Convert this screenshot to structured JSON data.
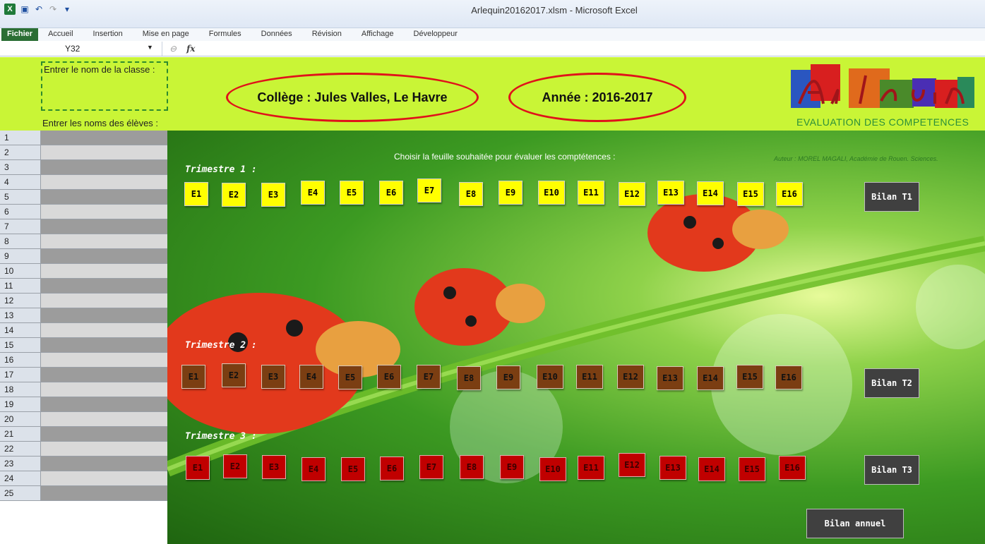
{
  "window": {
    "title": "Arlequin20162017.xlsm  -  Microsoft Excel"
  },
  "ribbon": {
    "tabs": [
      "Fichier",
      "Accueil",
      "Insertion",
      "Mise en page",
      "Formules",
      "Données",
      "Révision",
      "Affichage",
      "Développeur"
    ]
  },
  "formula_bar": {
    "name_box": "Y32",
    "fx": "fx",
    "value": ""
  },
  "header": {
    "class_prompt": "Entrer le nom de la classe :",
    "names_prompt": "Entrer les noms des élèves :",
    "college": "Collège : Jules Valles, Le Havre",
    "year": "Année : 2016-2017",
    "logo_subtitle": "EVALUATION DES COMPETENCES"
  },
  "instruction": "Choisir la feuille souhaitée pour évaluer les comptétences :",
  "author": "Auteur : MOREL MAGALI, Académie de Rouen. Sciences.",
  "rows": [
    "1",
    "2",
    "3",
    "4",
    "5",
    "6",
    "7",
    "8",
    "9",
    "10",
    "11",
    "12",
    "13",
    "14",
    "15",
    "16",
    "17",
    "18",
    "19",
    "20",
    "21",
    "22",
    "23",
    "24",
    "25"
  ],
  "trimesters": [
    {
      "label": "Trimestre 1 :",
      "bilan": "Bilan T1",
      "buttons": [
        "E1",
        "E2",
        "E3",
        "E4",
        "E5",
        "E6",
        "E7",
        "E8",
        "E9",
        "E10",
        "E11",
        "E12",
        "E13",
        "E14",
        "E15",
        "E16"
      ]
    },
    {
      "label": "Trimestre 2 :",
      "bilan": "Bilan T2",
      "buttons": [
        "E1",
        "E2",
        "E3",
        "E4",
        "E5",
        "E6",
        "E7",
        "E8",
        "E9",
        "E10",
        "E11",
        "E12",
        "E13",
        "E14",
        "E15",
        "E16"
      ]
    },
    {
      "label": "Trimestre 3 :",
      "bilan": "Bilan T3",
      "buttons": [
        "E1",
        "E2",
        "E3",
        "E4",
        "E5",
        "E6",
        "E7",
        "E8",
        "E9",
        "E10",
        "E11",
        "E12",
        "E13",
        "E14",
        "E15",
        "E16"
      ]
    }
  ],
  "bilan_annuel": "Bilan annuel",
  "colors": {
    "header_band": "#c9f536",
    "t1": "#ffff00",
    "t2": "#7b3e12",
    "t3": "#c00000",
    "bilan": "#404040",
    "oval": "#e0121a"
  }
}
